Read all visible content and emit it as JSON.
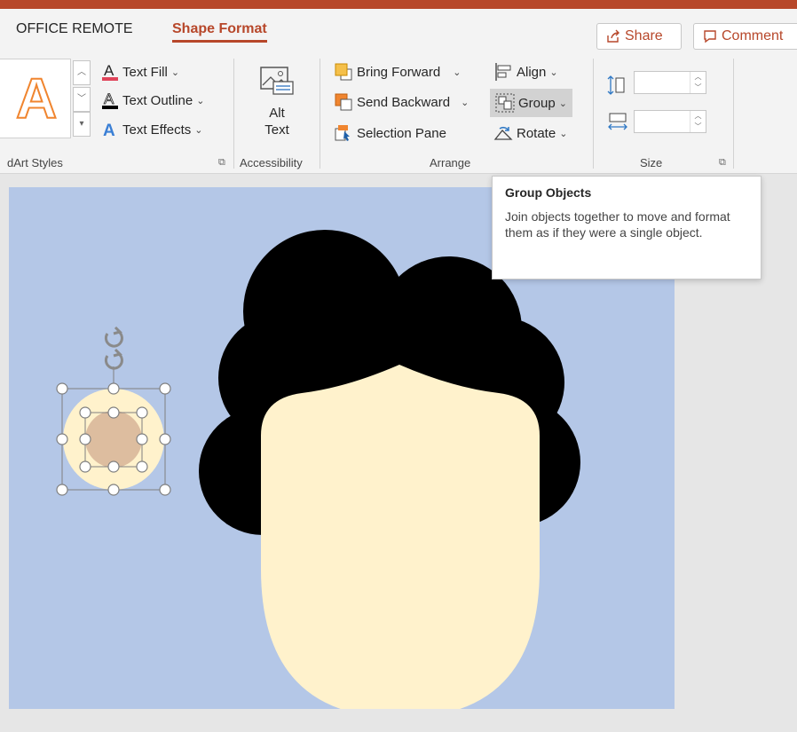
{
  "tabs": [
    {
      "label": "OFFICE REMOTE"
    },
    {
      "label": "Shape Format"
    }
  ],
  "top_buttons": {
    "share_label": "Share",
    "comments_label": "Comment"
  },
  "ribbon": {
    "wordart": {
      "text_fill": "Text Fill",
      "text_outline": "Text Outline",
      "text_effects": "Text Effects",
      "group_label": "dArt Styles"
    },
    "accessibility": {
      "alt_text_line1": "Alt",
      "alt_text_line2": "Text",
      "group_label": "Accessibility"
    },
    "arrange": {
      "bring_forward": "Bring Forward",
      "send_backward": "Send Backward",
      "selection_pane": "Selection Pane",
      "align": "Align",
      "group": "Group",
      "rotate": "Rotate",
      "group_label": "Arrange"
    },
    "size": {
      "height_value": "",
      "width_value": "",
      "group_label": "Size"
    }
  },
  "tooltip": {
    "title": "Group Objects",
    "body": "Join objects together to move and format them as if they were a single object."
  },
  "colors": {
    "accent": "#b7472a",
    "slide_background": "#b4c7e7",
    "face": "#fff2cc",
    "hair": "#000000",
    "eye_outer": "#fff2cc",
    "eye_inner": "#ddbd9f"
  }
}
